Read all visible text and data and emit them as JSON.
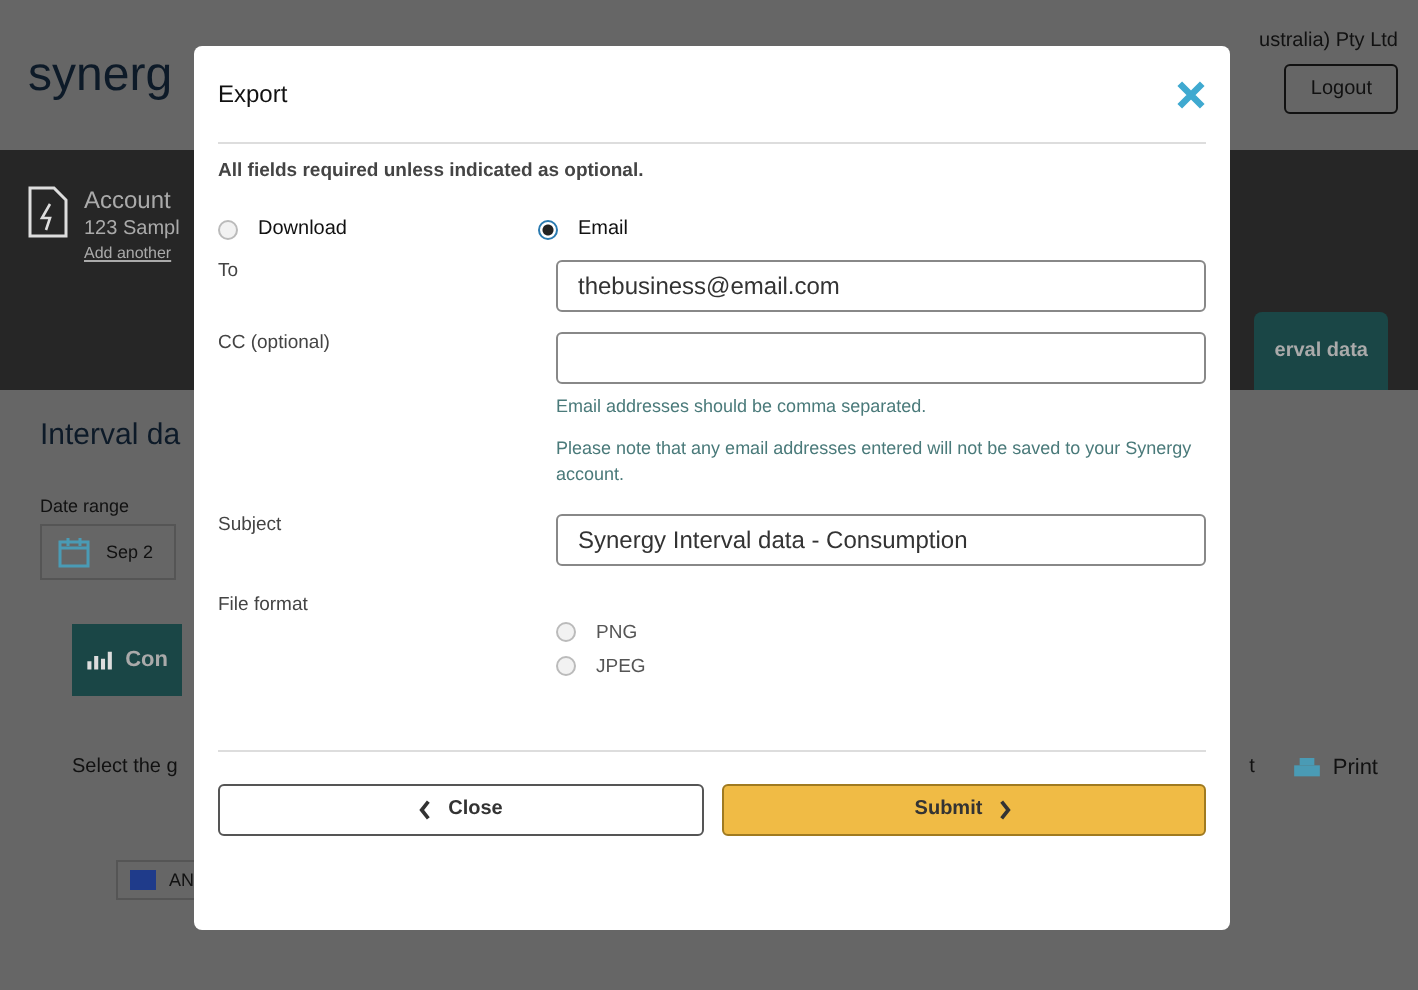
{
  "background_page": {
    "logo": "synerg",
    "company": "ustralia) Pty Ltd",
    "logout": "Logout",
    "account_title": "Account",
    "account_address": "123 Sampl",
    "add_link": "Add another",
    "tab_right": "erval data",
    "page_title": "Interval da",
    "date_label": "Date range",
    "date_value": "Sep 2",
    "tab_left": "Con",
    "select_text": "Select the g",
    "export_fragment": "t",
    "print": "Print",
    "dropdown": "AN"
  },
  "dialog": {
    "title": "Export",
    "note": "All fields required unless indicated as optional.",
    "delivery": [
      {
        "label": "Download",
        "selected": false
      },
      {
        "label": "Email",
        "selected": true
      }
    ],
    "fields": [
      {
        "label": "To",
        "value": "thebusiness@email.com"
      },
      {
        "label": "CC (optional)",
        "hints": [
          "Email addresses should be comma separated.",
          "Please note that any email addresses entered will not be saved to your Synergy account."
        ]
      },
      {
        "label": "Subject",
        "value": "Synergy Interval data - Consumption"
      }
    ],
    "file_format": {
      "label": "File format",
      "options": [
        {
          "label": "PNG",
          "selected": false
        },
        {
          "label": "JPEG",
          "selected": false
        }
      ]
    },
    "buttons": [
      {
        "label": "Close",
        "kind": "secondary"
      },
      {
        "label": "Submit",
        "kind": "primary"
      }
    ]
  }
}
